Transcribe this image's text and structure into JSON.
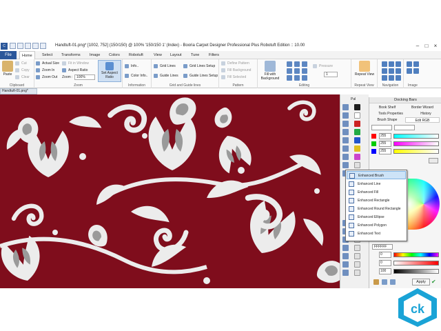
{
  "window": {
    "title": "Handtuft-01.png* [1002, 752] (150/150) @ 100% '150/150 1' (Index) - Booria Carpet Designer Professional Plus Robotuft Edition :: 10.00",
    "app_icon": "C"
  },
  "menu": {
    "file": "File",
    "tabs": [
      "Home",
      "Select",
      "Transforms",
      "Image",
      "Colors",
      "Robotuft",
      "View",
      "Layout",
      "Tune",
      "Filters"
    ],
    "active_tab": "Home"
  },
  "ribbon": {
    "clipboard": {
      "paste": "Paste",
      "cut": "Cut",
      "copy": "Copy",
      "clear": "Clear",
      "label": "Clipboard"
    },
    "zoom": {
      "actual_size": "Actual Size",
      "zoom_in": "Zoom In",
      "zoom_out": "Zoom Out",
      "fit_in_window": "Fit in Window",
      "aspect_ratio": "Aspect Ratio",
      "zoom_label": "Zoom :",
      "zoom_value": "100%",
      "set_aspect_ratio": "Set Aspect Ratio",
      "label": "Zoom"
    },
    "information": {
      "info": "Info..",
      "color_info": "Color Info..",
      "label": "Information"
    },
    "grid": {
      "grid_lines": "Grid Lines",
      "grid_lines_setup": "Grid Lines Setup",
      "guide_lines": "Guide Lines",
      "guide_lines_setup": "Guide Lines Setup",
      "label": "Grid and Guide lines"
    },
    "pattern": {
      "define_pattern": "Define Pattern",
      "fill_background": "Fill Background",
      "fill_selected": "Fill Selected",
      "label": "Pattern"
    },
    "editing": {
      "fill_with_background": "Fill with Background",
      "pressure": "Pressure",
      "pressure_value": "1",
      "label": "Editing"
    },
    "repeat": {
      "repeat_view": "Repeat View",
      "label": "Repeat View"
    },
    "navigation": {
      "label": "Navigation"
    },
    "image": {
      "label": "Image"
    }
  },
  "document_tab": "Handtuft-01.png*",
  "toolbox": {
    "header": "Pal"
  },
  "panel": {
    "title": "Docking Bars",
    "tabs": [
      "Book Shelf",
      "Border Wizard",
      "Tools Properties",
      "History",
      "Brush Shape",
      "Edit RGB"
    ],
    "active_tab": "Edit RGB",
    "rgb": [
      {
        "channel": "R",
        "value": "255",
        "color": "#ff0000"
      },
      {
        "channel": "G",
        "value": "255",
        "color": "#00cc00"
      },
      {
        "channel": "B",
        "value": "255",
        "color": "#0000ff"
      }
    ],
    "hex_value": "FFFFFF",
    "lower_values": [
      "0",
      "0",
      "100"
    ],
    "apply": "Apply"
  },
  "dropdown": {
    "items": [
      "Enhanced Brush",
      "Enhanced Line",
      "Enhanced Fill",
      "Enhanced Rectangle",
      "Enhanced Round Rectangle",
      "Enhanced Ellipse",
      "Enhanced Polygon",
      "Enhanced Text"
    ],
    "selected_index": 0
  },
  "watermark": {
    "logo_text": "ck"
  },
  "colors": {
    "accent": "#2b579a",
    "canvas_bg": "#7f0d1c",
    "pattern_fg": "#ececec",
    "pattern_gray": "#9a9a9a"
  }
}
